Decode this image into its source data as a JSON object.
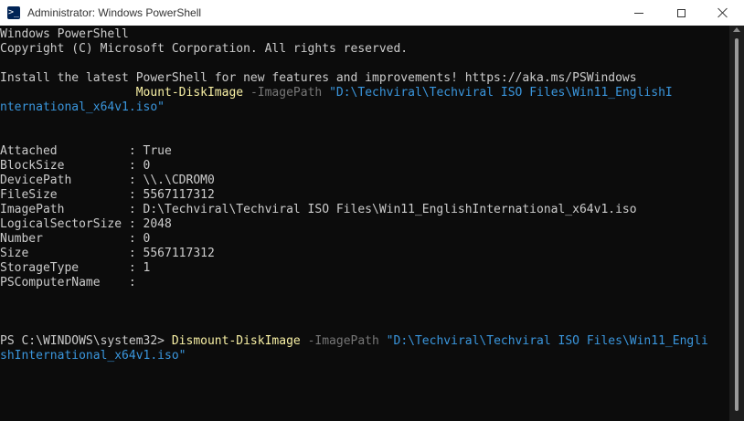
{
  "window": {
    "title": "Administrator: Windows PowerShell",
    "icon": "powershell-icon",
    "icon_glyph": ">_"
  },
  "colors": {
    "background": "#0c0c0c",
    "text": "#cccccc",
    "command": "#f9f1a5",
    "parameter": "#767676",
    "string": "#3a96dd"
  },
  "console": {
    "header_lines": [
      "Windows PowerShell",
      "Copyright (C) Microsoft Corporation. All rights reserved."
    ],
    "install_line": "Install the latest PowerShell for new features and improvements! https://aka.ms/PSWindows",
    "mount_command": {
      "indent": "                   ",
      "cmdlet": "Mount-DiskImage",
      "parameter": "-ImagePath",
      "value_part1": "\"D:\\Techviral\\Techviral ISO Files\\Win11_EnglishI",
      "value_part2": "nternational_x64v1.iso\""
    },
    "properties": [
      {
        "text": "Attached          : True"
      },
      {
        "text": "BlockSize         : 0"
      },
      {
        "text": "DevicePath        : \\\\.\\CDROM0"
      },
      {
        "text": "FileSize          : 5567117312"
      },
      {
        "text": "ImagePath         : D:\\Techviral\\Techviral ISO Files\\Win11_EnglishInternational_x64v1.iso"
      },
      {
        "text": "LogicalSectorSize : 2048"
      },
      {
        "text": "Number            : 0"
      },
      {
        "text": "Size              : 5567117312"
      },
      {
        "text": "StorageType       : 1"
      },
      {
        "text": "PSComputerName    :"
      }
    ],
    "dismount_command": {
      "prompt": "PS C:\\WINDOWS\\system32> ",
      "cmdlet": "Dismount-DiskImage",
      "parameter": "-ImagePath",
      "value_part1": "\"D:\\Techviral\\Techviral ISO Files\\Win11_Engli",
      "value_part2": "shInternational_x64v1.iso\""
    }
  }
}
